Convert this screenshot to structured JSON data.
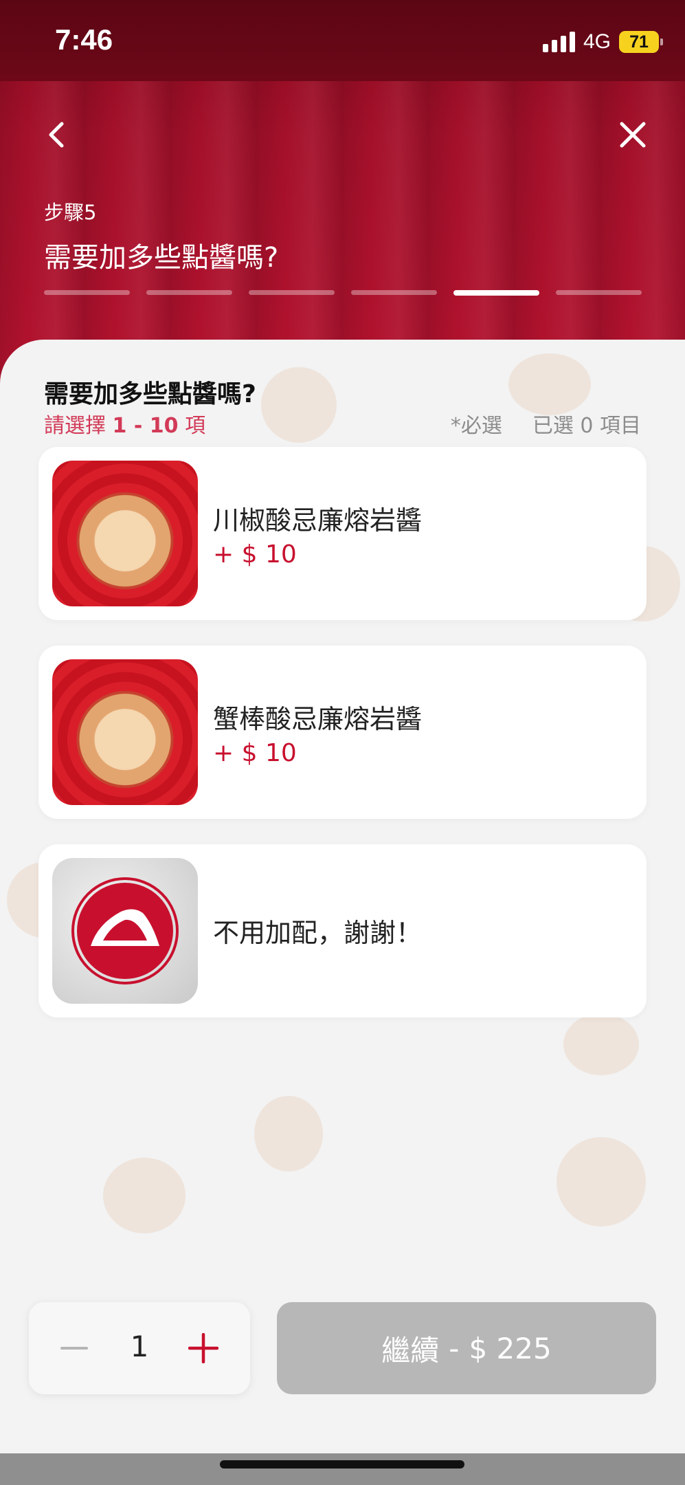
{
  "status_bar": {
    "time": "7:46",
    "network": "4G",
    "battery": "71"
  },
  "header": {
    "step_label": "步驟5",
    "title": "需要加多些點醬嗎?",
    "progress_total": 6,
    "progress_current": 5
  },
  "section": {
    "title": "需要加多些點醬嗎?",
    "select_prefix": "請選擇",
    "select_range": "1 - 10",
    "select_suffix": "項",
    "required": "*必選",
    "selected_count": "已選 0 項目"
  },
  "options": [
    {
      "name": "川椒酸忌廉熔岩醬",
      "price": "+ $ 10",
      "icon": "pizza-image"
    },
    {
      "name": "蟹棒酸忌廉熔岩醬",
      "price": "+ $ 10",
      "icon": "pizza-image"
    },
    {
      "name": "不用加配，謝謝！",
      "price": "",
      "icon": "pizza-hut-logo"
    }
  ],
  "bottom": {
    "quantity": "1",
    "continue_label": "繼續",
    "separator": "-",
    "total": "$ 225"
  },
  "colors": {
    "brand_red": "#c8102e",
    "subtitle_pink": "#d23a57",
    "button_disabled": "#b7b7b7"
  }
}
